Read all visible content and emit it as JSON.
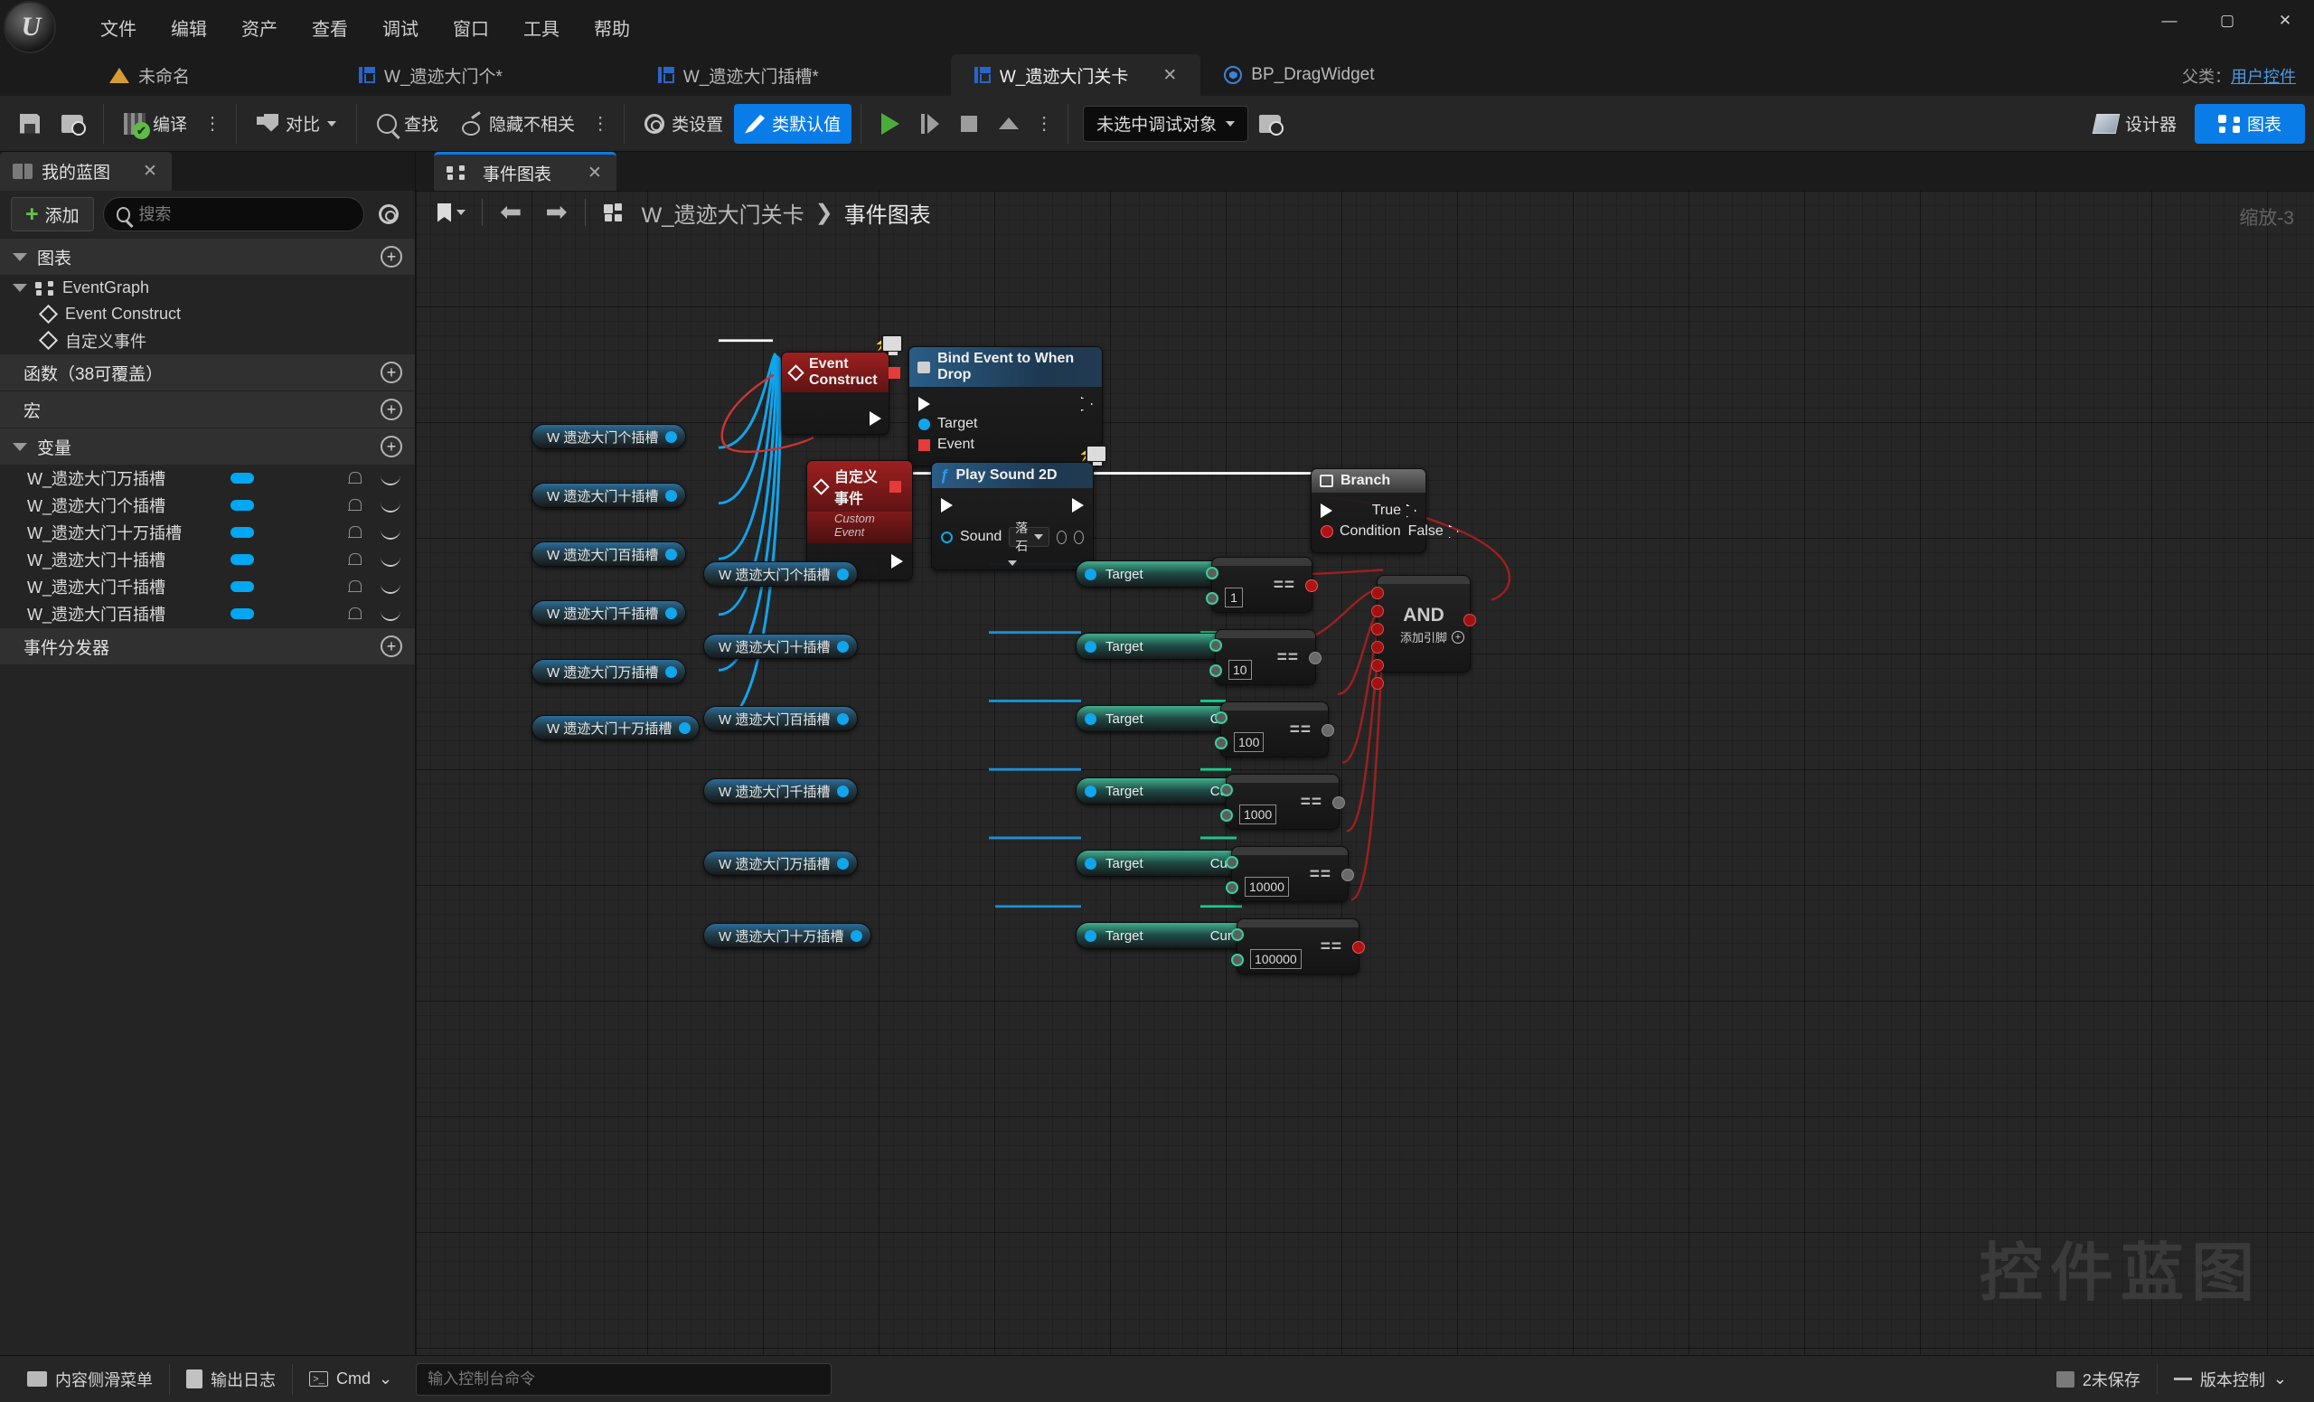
{
  "window": {
    "menu": [
      "文件",
      "编辑",
      "资产",
      "查看",
      "调试",
      "窗口",
      "工具",
      "帮助"
    ],
    "minimize": "—",
    "maximize": "▢",
    "close": "✕"
  },
  "tabs": {
    "items": [
      {
        "label": "未命名",
        "icon": "cone-icon",
        "active": false,
        "closable": false
      },
      {
        "label": "W_遗迹大门个*",
        "icon": "widget-icon",
        "active": false,
        "closable": false
      },
      {
        "label": "W_遗迹大门插槽*",
        "icon": "widget-icon",
        "active": false,
        "closable": false
      },
      {
        "label": "W_遗迹大门关卡",
        "icon": "widget-icon",
        "active": true,
        "closable": true
      },
      {
        "label": "BP_DragWidget",
        "icon": "blueprint-icon",
        "active": false,
        "closable": false
      }
    ],
    "close_glyph": "✕",
    "parent_class_label": "父类：",
    "parent_class_value": "用户控件"
  },
  "toolbar": {
    "save": "",
    "browse": "",
    "compile": "编译",
    "diff": "对比",
    "find": "查找",
    "hide_unrelated": "隐藏不相关",
    "class_settings": "类设置",
    "class_defaults": "类默认值",
    "debug_object": "未选中调试对象",
    "designer": "设计器",
    "graph": "图表",
    "dots": "⋮",
    "caret": "⌄"
  },
  "my_blueprint": {
    "tab_label": "我的蓝图",
    "close_glyph": "✕",
    "add_button": "添加",
    "search_placeholder": "搜索",
    "search_value": "",
    "sections": {
      "graphs": {
        "label": "图表",
        "add": "+"
      },
      "functions": {
        "label": "函数（38可覆盖）",
        "add": "+"
      },
      "macros": {
        "label": "宏",
        "add": "+"
      },
      "variables": {
        "label": "变量",
        "add": "+"
      },
      "dispatchers": {
        "label": "事件分发器",
        "add": "+"
      }
    },
    "graph_tree": {
      "event_graph": "EventGraph",
      "children": [
        "Event Construct",
        "自定义事件"
      ]
    },
    "variables": [
      {
        "name": "W_遗迹大门万插槽"
      },
      {
        "name": "W_遗迹大门个插槽"
      },
      {
        "name": "W_遗迹大门十万插槽"
      },
      {
        "name": "W_遗迹大门十插槽"
      },
      {
        "name": "W_遗迹大门千插槽"
      },
      {
        "name": "W_遗迹大门百插槽"
      }
    ]
  },
  "graph": {
    "tab_label": "事件图表",
    "close_glyph": "✕",
    "breadcrumb_root": "W_遗迹大门关卡",
    "breadcrumb_sep": "❯",
    "breadcrumb_current": "事件图表",
    "zoom_label": "缩放-3",
    "watermark": "控件蓝图",
    "back_glyph": "⬅",
    "forward_glyph": "➡"
  },
  "nodes": {
    "event_construct": {
      "title": "Event Construct"
    },
    "bind_event": {
      "title": "Bind Event to When Drop",
      "pins": [
        "Target",
        "Event"
      ]
    },
    "custom_event": {
      "title": "自定义事件",
      "subtitle": "Custom Event"
    },
    "play_sound": {
      "title": "Play Sound 2D",
      "sound_label": "Sound",
      "sound_value": "落石",
      "fn_glyph": "ƒ"
    },
    "branch": {
      "title": "Branch",
      "true_label": "True",
      "false_label": "False",
      "condition_label": "Condition"
    },
    "and_node": {
      "title": "AND",
      "add_pin": "添加引脚",
      "add_glyph": "+"
    },
    "purefn_labels": {
      "target": "Target",
      "out": "Cur Num"
    },
    "eq_symbol": "==",
    "getters_left": [
      "W 遗迹大门个插槽",
      "W 遗迹大门十插槽",
      "W 遗迹大门百插槽",
      "W 遗迹大门千插槽",
      "W 遗迹大门万插槽",
      "W 遗迹大门十万插槽"
    ],
    "rows": [
      {
        "getter": "W 遗迹大门个插槽",
        "compare": "1"
      },
      {
        "getter": "W 遗迹大门十插槽",
        "compare": "10"
      },
      {
        "getter": "W 遗迹大门百插槽",
        "compare": "100"
      },
      {
        "getter": "W 遗迹大门千插槽",
        "compare": "1000"
      },
      {
        "getter": "W 遗迹大门万插槽",
        "compare": "10000"
      },
      {
        "getter": "W 遗迹大门十万插槽",
        "compare": "100000"
      }
    ]
  },
  "statusbar": {
    "content_drawer": "内容侧滑菜单",
    "output_log": "输出日志",
    "cmd_label": "Cmd",
    "cmd_caret": "⌄",
    "cmd_placeholder": "输入控制台命令",
    "unsaved": "2未保存",
    "source_control": "版本控制",
    "sc_caret": "⌄"
  },
  "colors": {
    "accent_blue": "#0a7ce8",
    "exec_white": "#ffffff",
    "pin_blue": "#10a5ec",
    "pin_green": "#18c98b",
    "pin_red": "#b11212",
    "event_red": "#9e1f1f"
  }
}
